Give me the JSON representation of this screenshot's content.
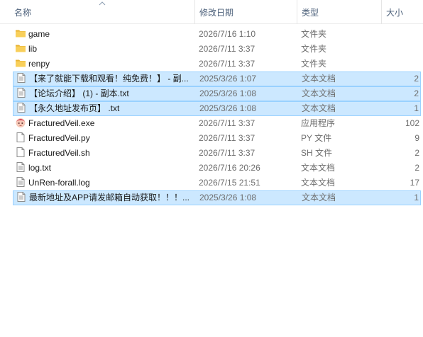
{
  "columns": {
    "name": "名称",
    "date": "修改日期",
    "type": "类型",
    "size": "大小"
  },
  "files": [
    {
      "name": "game",
      "date": "2026/7/16 1:10",
      "type": "文件夹",
      "size": "",
      "icon": "folder-icon",
      "selected": false
    },
    {
      "name": "lib",
      "date": "2026/7/11 3:37",
      "type": "文件夹",
      "size": "",
      "icon": "folder-icon",
      "selected": false
    },
    {
      "name": "renpy",
      "date": "2026/7/11 3:37",
      "type": "文件夹",
      "size": "",
      "icon": "folder-icon",
      "selected": false
    },
    {
      "name": "【来了就能下载和观看！纯免费！】 - 副...",
      "date": "2025/3/26 1:07",
      "type": "文本文档",
      "size": "2",
      "icon": "text-file-icon",
      "selected": true
    },
    {
      "name": "【论坛介绍】 (1) - 副本.txt",
      "date": "2025/3/26 1:08",
      "type": "文本文档",
      "size": "2",
      "icon": "text-file-icon",
      "selected": true
    },
    {
      "name": "【永久地址发布页】 .txt",
      "date": "2025/3/26 1:08",
      "type": "文本文档",
      "size": "1",
      "icon": "text-file-icon",
      "selected": true
    },
    {
      "name": "FracturedVeil.exe",
      "date": "2026/7/11 3:37",
      "type": "应用程序",
      "size": "102",
      "icon": "app-icon",
      "selected": false
    },
    {
      "name": "FracturedVeil.py",
      "date": "2026/7/11 3:37",
      "type": "PY 文件",
      "size": "9",
      "icon": "blank-file-icon",
      "selected": false
    },
    {
      "name": "FracturedVeil.sh",
      "date": "2026/7/11 3:37",
      "type": "SH 文件",
      "size": "2",
      "icon": "blank-file-icon",
      "selected": false
    },
    {
      "name": "log.txt",
      "date": "2026/7/16 20:26",
      "type": "文本文档",
      "size": "2",
      "icon": "text-file-icon",
      "selected": false
    },
    {
      "name": "UnRen-forall.log",
      "date": "2026/7/15 21:51",
      "type": "文本文档",
      "size": "17",
      "icon": "text-file-icon",
      "selected": false
    },
    {
      "name": "最新地址及APP请发邮箱自动获取！！！...",
      "date": "2025/3/26 1:08",
      "type": "文本文档",
      "size": "1",
      "icon": "text-file-icon",
      "selected": true
    }
  ],
  "colors": {
    "selection_fill": "#cce8ff",
    "selection_border": "#99d1ff",
    "header_text": "#4c607a",
    "folder": "#f5c542"
  }
}
